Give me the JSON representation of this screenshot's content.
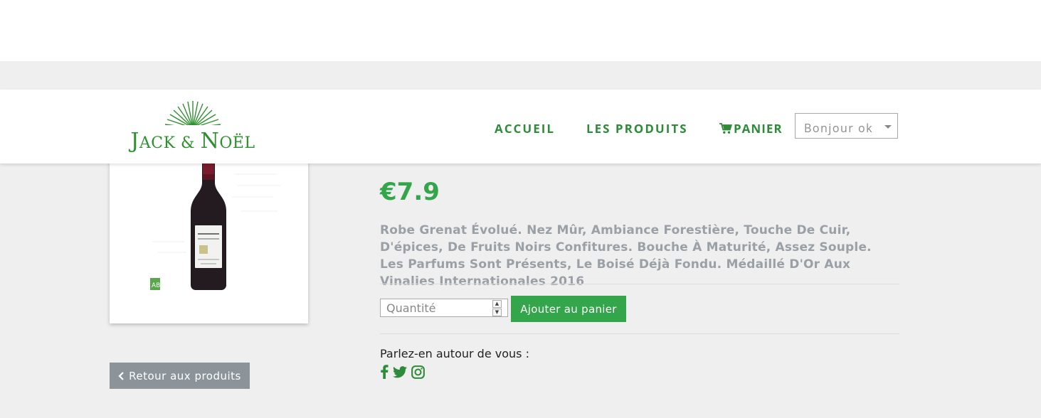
{
  "header": {
    "brand": {
      "main": "J",
      "small1": "ACK & ",
      "main2": "N",
      "small2": "OËL"
    },
    "nav": {
      "accueil": "ACCUEIL",
      "produits": "LES PRODUITS",
      "panier": "PANIER"
    },
    "user_menu": {
      "label": "Bonjour ok"
    }
  },
  "product": {
    "price": "€7.9",
    "description": "Robe Grenat Évolué. Nez Mûr, Ambiance Forestière, Touche De Cuir, D'épices, De Fruits Noirs Confitures. Bouche À Maturité, Assez Souple. Les Parfums Sont Présents, Le Boisé Déjà Fondu. Médaillé D'Or Aux Vinalies Internationales 2016",
    "quantity_placeholder": "Quantité",
    "add_to_cart": "Ajouter au panier"
  },
  "back_button": {
    "label": "Retour aux produits"
  },
  "share": {
    "label": "Parlez-en autour de vous :",
    "icons": [
      "facebook-icon",
      "twitter-icon",
      "instagram-icon"
    ]
  },
  "colors": {
    "brand_green": "#2e8b3a",
    "price_green": "#33a54a",
    "back_button_gray": "#8c949a",
    "page_background": "#efefef"
  }
}
